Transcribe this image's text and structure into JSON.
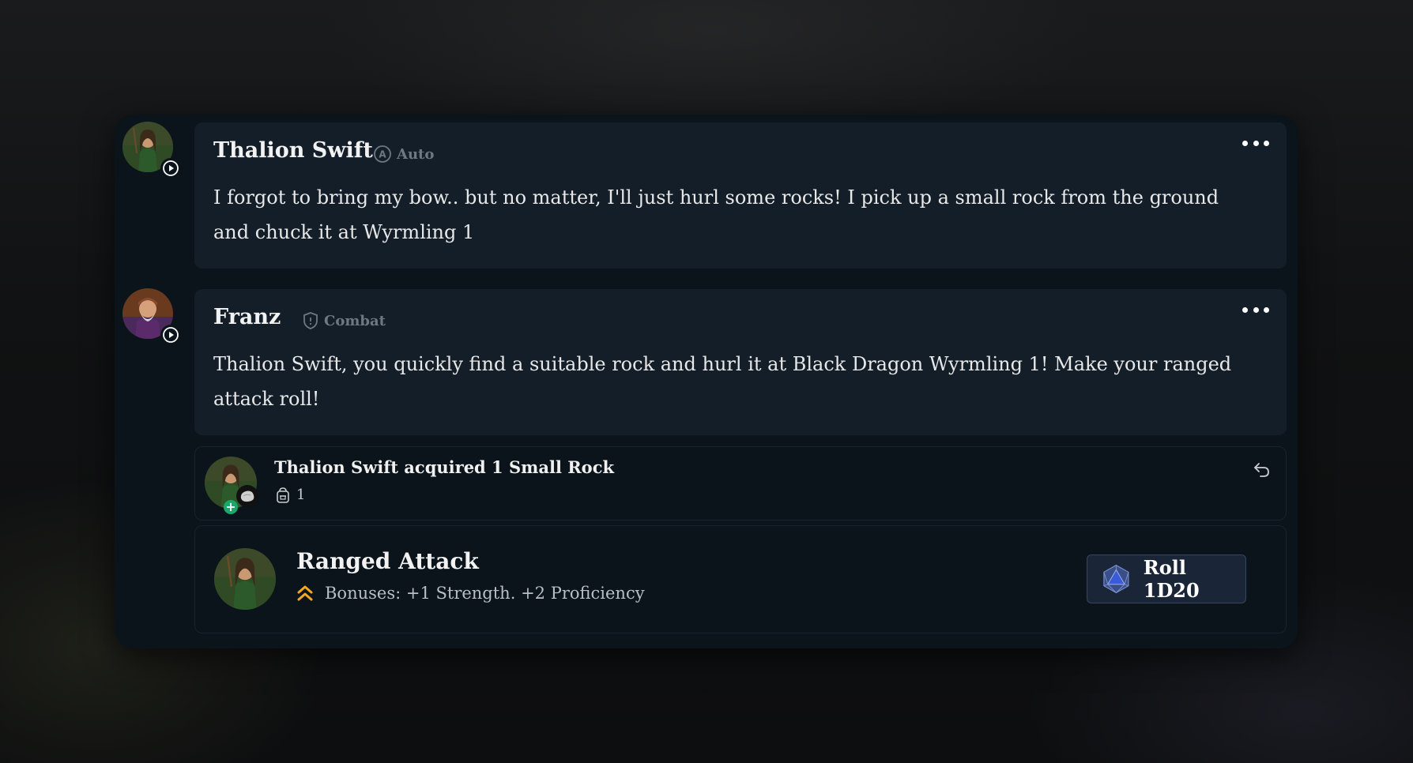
{
  "messages": [
    {
      "name": "Thalion Swift",
      "mode": "Auto",
      "mode_icon": "auto-circle-icon",
      "text": "I forgot to bring my bow.. but no matter, I'll just hurl some rocks! I pick up a small rock from the ground and chuck it at Wyrmling 1"
    },
    {
      "name": "Franz",
      "mode": "Combat",
      "mode_icon": "shield-icon",
      "text": "Thalion Swift, you quickly find a suitable rock and hurl it at Black Dragon Wyrmling 1! Make your ranged attack roll!"
    }
  ],
  "acquisition": {
    "title": "Thalion Swift acquired 1 Small Rock",
    "count": "1"
  },
  "attack": {
    "title": "Ranged Attack",
    "bonuses": "Bonuses: +1 Strength. +2 Proficiency",
    "roll_label": "Roll 1D20"
  },
  "colors": {
    "panel": "#0b141b",
    "message_bg": "#141e29",
    "accent_orange": "#f5a623",
    "badge_green": "#19a86a",
    "dice_blue": "#3a5bd9"
  }
}
